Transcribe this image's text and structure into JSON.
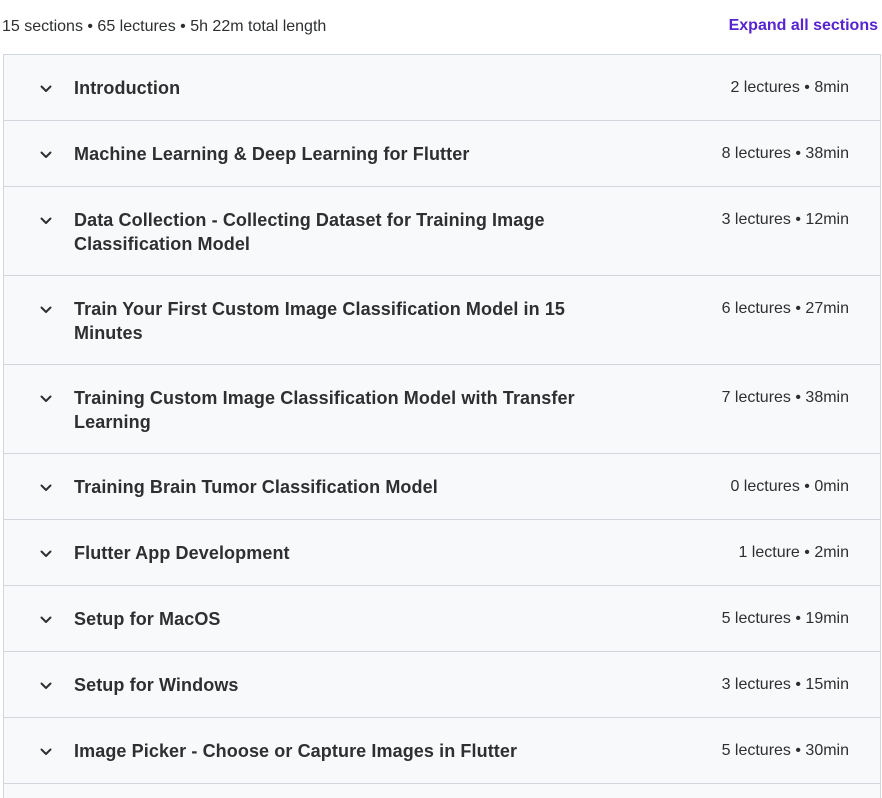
{
  "header": {
    "summary": "15 sections • 65 lectures • 5h 22m total length",
    "expand_all_label": "Expand all sections"
  },
  "colors": {
    "accent": "#5624d0",
    "section_bg": "#f7f9fa",
    "border": "#d1d7dc",
    "text": "#2d2f31"
  },
  "icons": {
    "section_toggle": "chevron-down-icon"
  },
  "sections": [
    {
      "title": "Introduction",
      "meta": "2 lectures • 8min"
    },
    {
      "title": "Machine Learning & Deep Learning for Flutter",
      "meta": "8 lectures • 38min"
    },
    {
      "title": "Data Collection - Collecting Dataset for Training Image Classification Model",
      "meta": "3 lectures • 12min"
    },
    {
      "title": "Train Your First Custom Image Classification Model in 15 Minutes",
      "meta": "6 lectures • 27min"
    },
    {
      "title": "Training Custom Image Classification Model with Transfer Learning",
      "meta": "7 lectures • 38min"
    },
    {
      "title": "Training Brain Tumor Classification Model",
      "meta": "0 lectures • 0min"
    },
    {
      "title": "Flutter App Development",
      "meta": "1 lecture • 2min"
    },
    {
      "title": "Setup for MacOS",
      "meta": "5 lectures • 19min"
    },
    {
      "title": "Setup for Windows",
      "meta": "3 lectures • 15min"
    },
    {
      "title": "Image Picker - Choose or Capture Images in Flutter",
      "meta": "5 lectures • 30min"
    }
  ]
}
